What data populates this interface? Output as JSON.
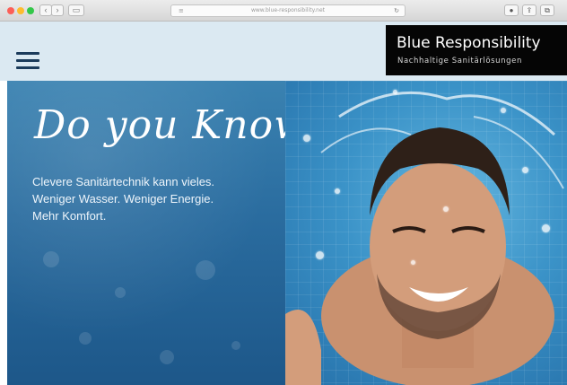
{
  "browser": {
    "url": "www.blue-responsibility.net",
    "back_icon": "chevron-left-icon",
    "forward_icon": "chevron-right-icon"
  },
  "site": {
    "brand_title": "Blue Responsibility",
    "brand_subtitle": "Nachhaltige Sanitärlösungen"
  },
  "hero": {
    "headline": "Do you Know?",
    "lines": [
      "Clevere Sanitärtechnik kann vieles.",
      "Weniger Wasser. Weniger Energie.",
      "Mehr Komfort."
    ],
    "image_alt_icon": "splashing-water-face-photo"
  },
  "colors": {
    "header_bg": "#dbe9f2",
    "brand_box": "#050505",
    "hero_blue": "#2a6c9f"
  }
}
